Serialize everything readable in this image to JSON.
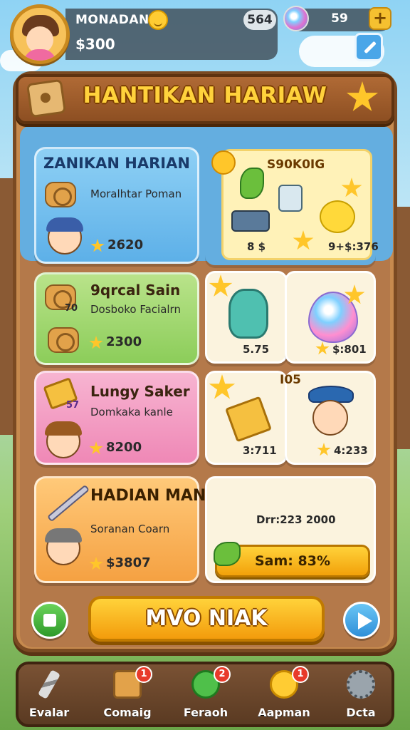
{
  "profile": {
    "name": "MONADANA",
    "money": "$300",
    "count": "564",
    "gems": "59",
    "plus": "+"
  },
  "header": {
    "title": "HANTIKAN HARIAW"
  },
  "cards": [
    {
      "title": "ZANIKAN HARIAN",
      "subtitle": "Moralhtar Poman",
      "price": "2620"
    },
    {
      "title": "9qrcal Sain",
      "subtitle": "Dosboko Facialrn",
      "price": "2300",
      "badge": "70"
    },
    {
      "title": "Lungy Saker",
      "subtitle": "Domkaka kanle",
      "price": "8200",
      "badge": "57"
    },
    {
      "title": "HADIAN MANAKIK",
      "subtitle": "Soranan Coarn",
      "price": "$3807"
    }
  ],
  "rewards": {
    "big": {
      "title": "S90K0IG",
      "label_left": "8 $",
      "label_right": "9+$:376"
    },
    "green_left": {
      "value": "5.75"
    },
    "green_right": {
      "value": "$:801"
    },
    "pink_left": {
      "value": "3:711"
    },
    "pink_right": {
      "tag": "I05",
      "value": "4:233"
    },
    "orange": {
      "detail": "Drr:223 2000",
      "button": "Sam: 83%"
    }
  },
  "main_button": "MVO NIAK",
  "bottom_nav": [
    {
      "label": "Evalar",
      "icon": "pencil-icon",
      "badge": ""
    },
    {
      "label": "Comaig",
      "icon": "box-icon",
      "badge": "1"
    },
    {
      "label": "Feraoh",
      "icon": "chat-icon",
      "badge": "2"
    },
    {
      "label": "Aapman",
      "icon": "smile-icon",
      "badge": "1"
    },
    {
      "label": "Dcta",
      "icon": "gear-icon",
      "badge": ""
    }
  ],
  "colors": {
    "accent": "#ffc62a",
    "board": "#c68a4e",
    "blue_card": "#5db0e8",
    "green_card": "#8ccd5a",
    "pink_card": "#ef88b6",
    "orange_card": "#f5a142"
  }
}
